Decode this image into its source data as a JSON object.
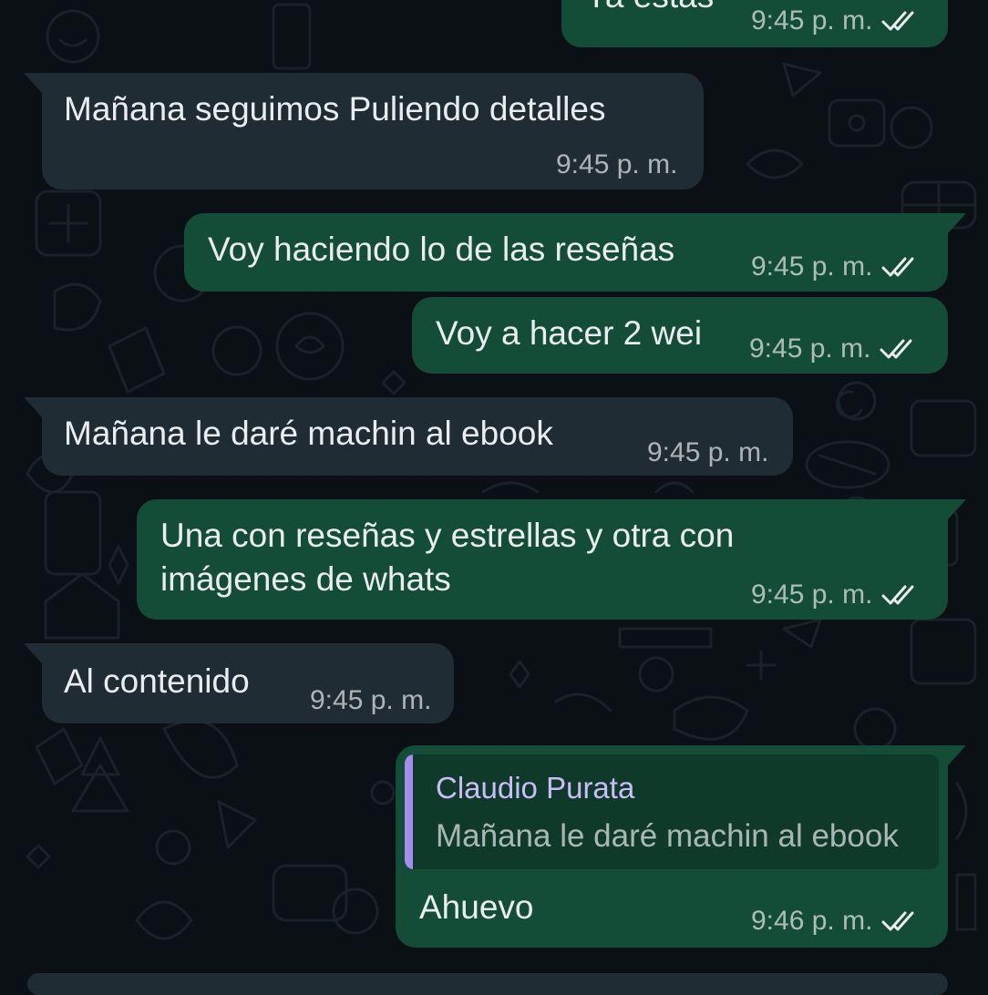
{
  "theme": {
    "background": "#0b1014",
    "incoming_bubble": "#202c33",
    "outgoing_bubble": "#144d37",
    "read_ticks": "#e9edef",
    "quote_accent": "#a68df0"
  },
  "messages": [
    {
      "direction": "outgoing",
      "text": "Ya estás",
      "time": "9:45 p. m.",
      "status_icon": "double-check-icon"
    },
    {
      "direction": "incoming",
      "text": "Mañana seguimos Puliendo detalles",
      "time": "9:45 p. m."
    },
    {
      "direction": "outgoing",
      "text": "Voy haciendo lo de las reseñas",
      "time": "9:45 p. m.",
      "status_icon": "double-check-icon"
    },
    {
      "direction": "outgoing",
      "text": "Voy a hacer 2 wei",
      "time": "9:45 p. m.",
      "status_icon": "double-check-icon"
    },
    {
      "direction": "incoming",
      "text": "Mañana le daré machin al ebook",
      "time": "9:45 p. m."
    },
    {
      "direction": "outgoing",
      "text_line1": "Una con reseñas y estrellas y otra con",
      "text_line2": "imágenes de whats",
      "time": "9:45 p. m.",
      "status_icon": "double-check-icon"
    },
    {
      "direction": "incoming",
      "text": "Al contenido",
      "time": "9:45 p. m."
    },
    {
      "direction": "outgoing",
      "quote_author": "Claudio Purata",
      "quote_text": "Mañana le daré machin al ebook",
      "text": "Ahuevo",
      "time": "9:46 p. m.",
      "status_icon": "double-check-icon"
    }
  ]
}
